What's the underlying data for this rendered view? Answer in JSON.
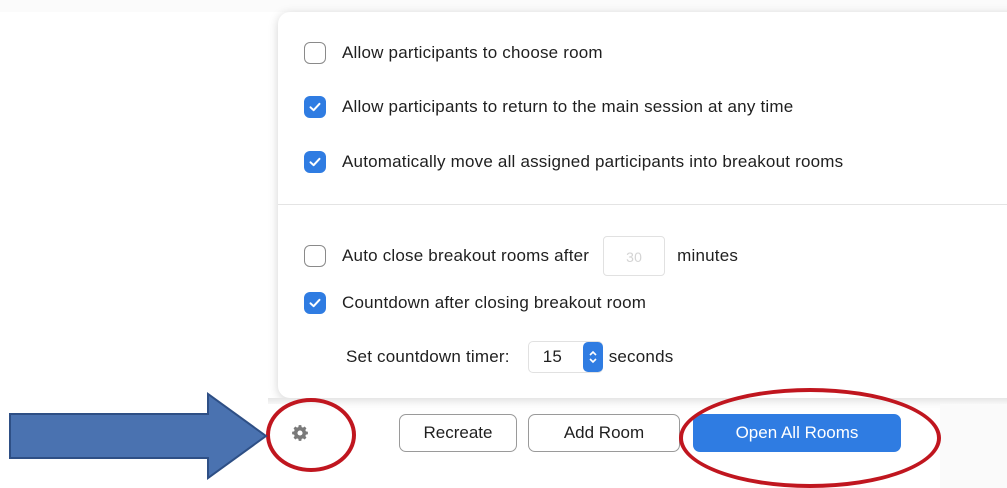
{
  "options": [
    {
      "label": "Allow participants to choose room",
      "checked": false
    },
    {
      "label": "Allow participants to return to the main session at any time",
      "checked": true
    },
    {
      "label": "Automatically move all assigned participants into breakout rooms",
      "checked": true
    }
  ],
  "auto_close": {
    "label": "Auto close breakout rooms after",
    "value": "30",
    "unit": "minutes",
    "checked": false
  },
  "countdown": {
    "label": "Countdown after closing breakout room",
    "checked": true
  },
  "timer": {
    "label": "Set countdown timer:",
    "value": "15",
    "unit": "seconds"
  },
  "footer": {
    "recreate": "Recreate",
    "add_room": "Add Room",
    "open_all": "Open All Rooms"
  },
  "colors": {
    "accent": "#2f7ce2",
    "annotation_ring": "#c0161f",
    "annotation_arrow": "#4a72b0"
  },
  "icons": {
    "settings": "gear-icon",
    "checkmark": "check-icon",
    "stepper": "up-down-chevron-icon",
    "annotation": "right-arrow-icon"
  }
}
